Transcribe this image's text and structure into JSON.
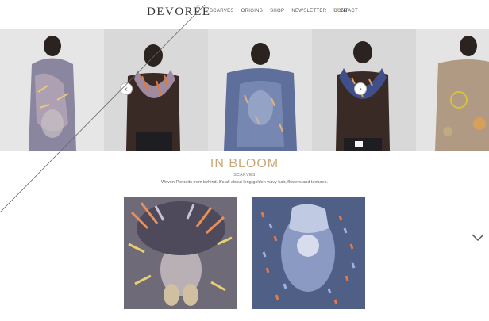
{
  "brand": {
    "logo": "DEVORÉE"
  },
  "nav": {
    "items": [
      "SCARVES",
      "ORIGINS",
      "SHOP",
      "NEWSLETTER",
      "CONTACT"
    ],
    "lang": {
      "fr": "FR",
      "sep": "/",
      "en": "EN"
    }
  },
  "collection": {
    "title": "IN BLOOM",
    "subtitle": "SCARVES",
    "description": "Woven Portraits from behind. It's all about long golden wavy hair, flowers and textures."
  },
  "icons": {
    "carousel_prev": "chevron-left-icon",
    "carousel_next": "chevron-right-icon",
    "scroll_down": "chevron-down-icon"
  }
}
